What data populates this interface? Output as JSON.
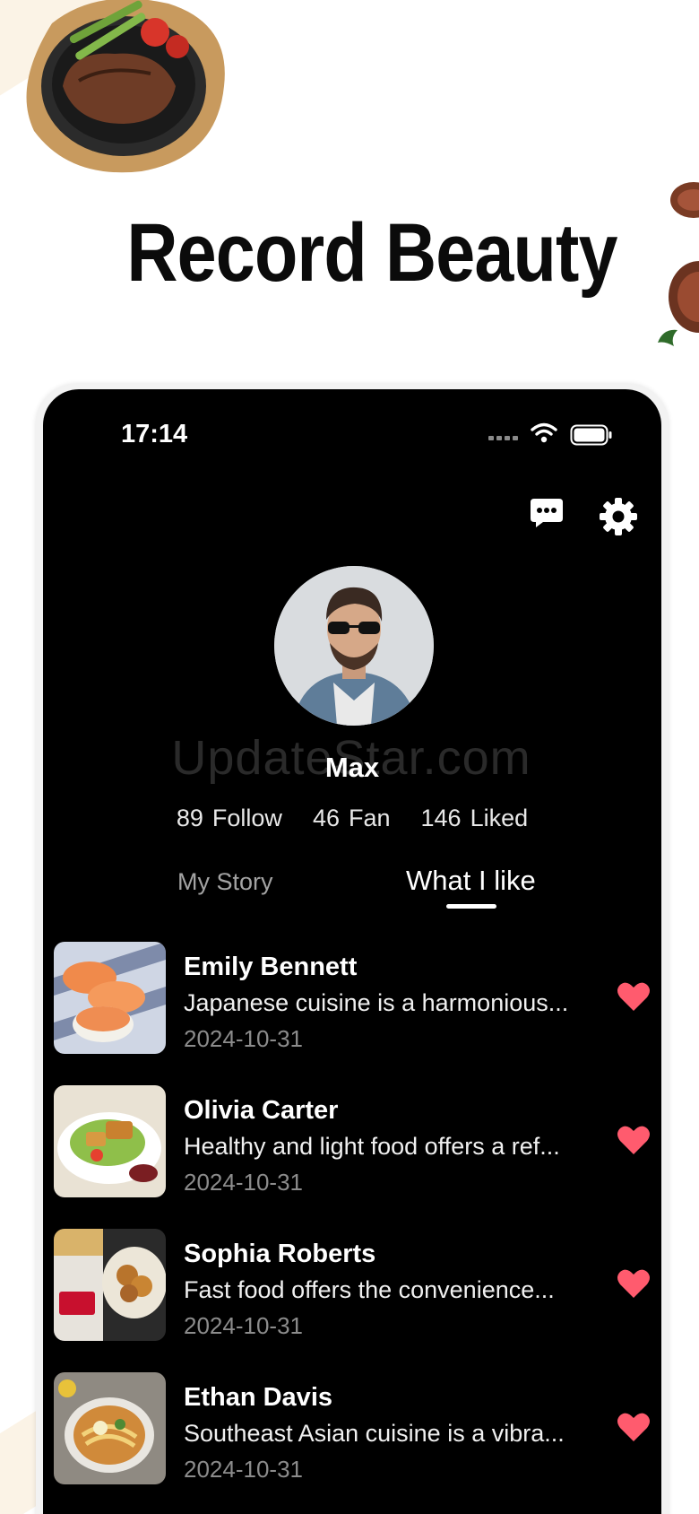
{
  "promo": {
    "title": "Record Beauty"
  },
  "status_bar": {
    "time": "17:14"
  },
  "watermark": "UpdateStar.com",
  "profile": {
    "username": "Max",
    "stats": [
      {
        "count": "89",
        "label": "Follow"
      },
      {
        "count": "46",
        "label": "Fan"
      },
      {
        "count": "146",
        "label": "Liked"
      }
    ]
  },
  "tabs": [
    {
      "label": "My Story",
      "active": false
    },
    {
      "label": "What I like",
      "active": true
    }
  ],
  "liked_posts": [
    {
      "author": "Emily Bennett",
      "excerpt": "Japanese cuisine is a harmonious...",
      "date": "2024-10-31",
      "thumb": "sushi",
      "liked": true
    },
    {
      "author": "Olivia Carter",
      "excerpt": "Healthy and light food offers a ref...",
      "date": "2024-10-31",
      "thumb": "salad",
      "liked": true
    },
    {
      "author": "Sophia Roberts",
      "excerpt": "Fast food offers the convenience...",
      "date": "2024-10-31",
      "thumb": "fried-chicken",
      "liked": true
    },
    {
      "author": "Ethan Davis",
      "excerpt": "Southeast Asian cuisine is a vibra...",
      "date": "2024-10-31",
      "thumb": "noodle-soup",
      "liked": true
    }
  ],
  "colors": {
    "heart": "#ff5b6e",
    "screen_bg": "#000000",
    "promo_accent": "#fbf3e6"
  }
}
